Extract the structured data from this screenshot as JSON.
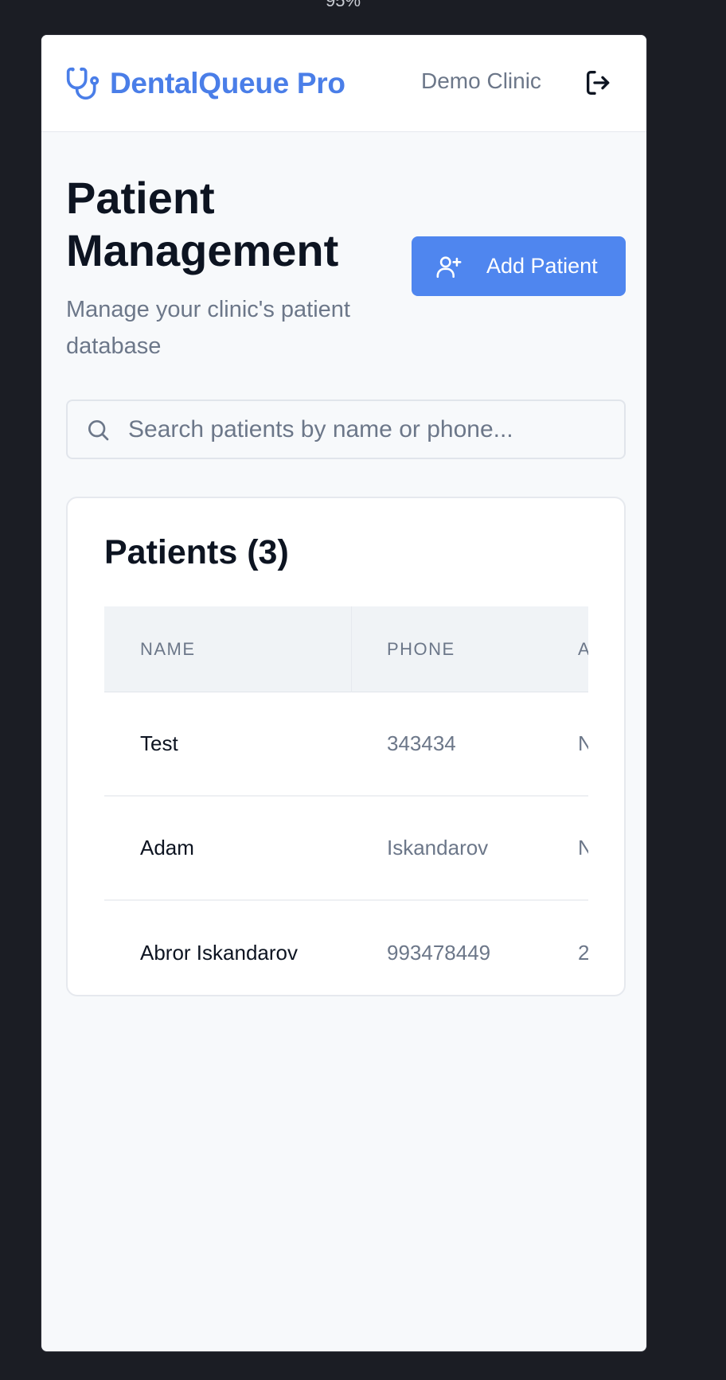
{
  "zoom": "95%",
  "header": {
    "brand_name": "DentalQueue Pro",
    "clinic_name": "Demo Clinic"
  },
  "page": {
    "title": "Patient Management",
    "subtitle": "Manage your clinic's patient database",
    "add_button_label": "Add Patient"
  },
  "search": {
    "placeholder": "Search patients by name or phone..."
  },
  "patients_card": {
    "title": "Patients (3)",
    "columns": [
      "NAME",
      "PHONE",
      "A"
    ],
    "rows": [
      {
        "name": "Test",
        "phone": "343434",
        "extra": "N"
      },
      {
        "name": "Adam",
        "phone": "Iskandarov",
        "extra": "N"
      },
      {
        "name": "Abror Iskandarov",
        "phone": "993478449",
        "extra": "2"
      }
    ]
  },
  "colors": {
    "brand": "#4a7ee8",
    "primary_button": "#4f86ef",
    "background": "#f7f9fb",
    "outer_background": "#1b1d24"
  }
}
